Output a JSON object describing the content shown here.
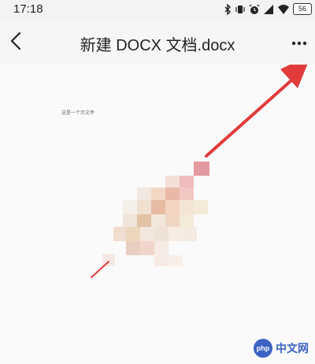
{
  "status_bar": {
    "time": "17:18",
    "battery_level": "56",
    "icons": [
      "bluetooth-icon",
      "vibrate-icon",
      "alarm-icon",
      "signal-icon",
      "wifi-icon",
      "battery-icon"
    ]
  },
  "nav": {
    "back_icon": "back-arrow-icon",
    "title": "新建 DOCX 文档.docx",
    "more_icon": "more-options-icon"
  },
  "document": {
    "line_1": "这是一个示文件"
  },
  "annotation": {
    "arrow_color": "#e23b3b"
  },
  "watermark": {
    "logo_text": "php",
    "text": "中文网"
  }
}
